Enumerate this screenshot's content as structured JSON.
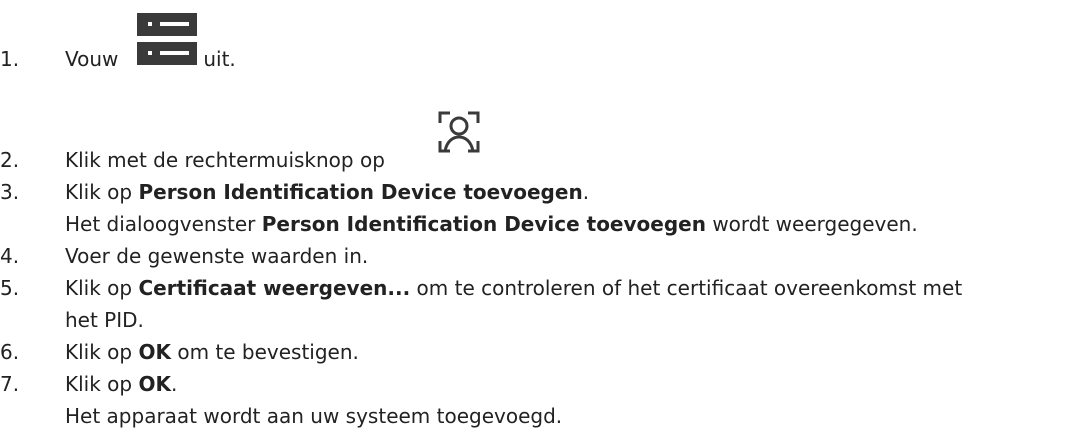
{
  "steps": [
    {
      "number": "1.",
      "before": "Vouw ",
      "icon": "server-list-icon",
      "after": " uit."
    },
    {
      "number": "2.",
      "before": "Klik met de rechtermuisknop op ",
      "icon": "person-identification-icon"
    },
    {
      "number": "3.",
      "before": "Klik op ",
      "bold": "Person Identification Device toevoegen",
      "after": ".",
      "result_before": "Het dialoogvenster ",
      "result_bold": "Person Identification Device toevoegen",
      "result_after": " wordt weergegeven."
    },
    {
      "number": "4.",
      "text": "Voer de gewenste waarden in."
    },
    {
      "number": "5.",
      "before": "Klik op ",
      "bold": "Certificaat weergeven...",
      "after": " om te controleren of het certificaat overeenkomst met",
      "continuation": "het PID."
    },
    {
      "number": "6.",
      "before": "Klik op ",
      "bold": "OK",
      "after": " om te bevestigen."
    },
    {
      "number": "7.",
      "before": "Klik op ",
      "bold": "OK",
      "after": ".",
      "result": "Het apparaat wordt aan uw systeem toegevoegd."
    }
  ],
  "colors": {
    "text": "#222222",
    "icon_dark": "#3a3a3a",
    "icon_light": "#ffffff"
  }
}
